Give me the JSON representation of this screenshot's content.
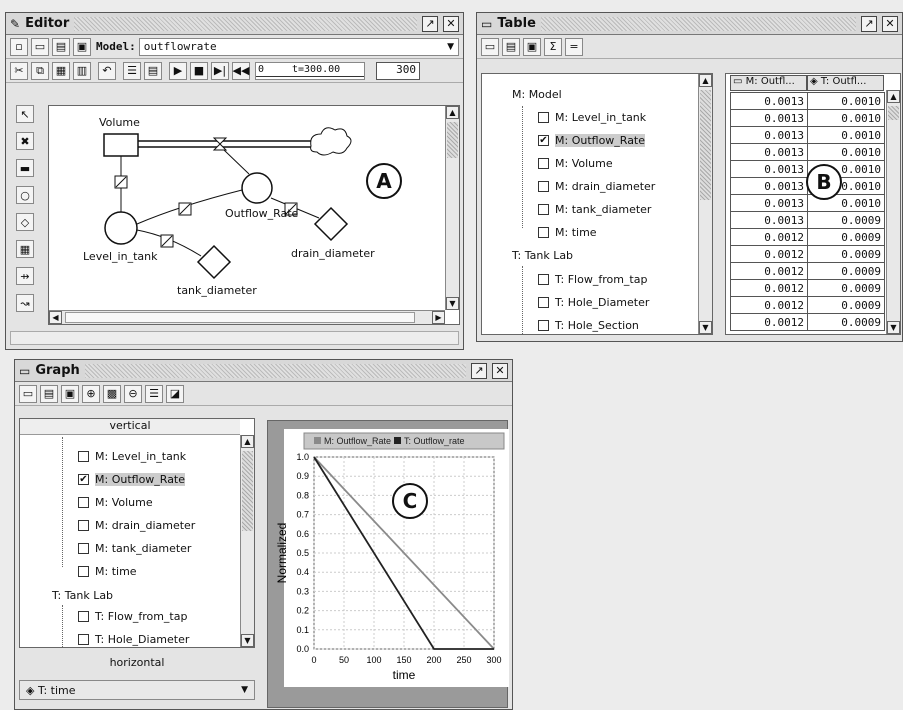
{
  "editor": {
    "title": "Editor",
    "model_label": "Model:",
    "model_value": "outflowrate",
    "time_start": "0",
    "time_display": "t=300.00",
    "time_end": "300",
    "nodes": {
      "volume": "Volume",
      "level": "Level_in_tank",
      "outflow": "Outflow_Rate",
      "drain": "drain_diameter",
      "tank": "tank_diameter"
    },
    "marker": "A"
  },
  "table": {
    "title": "Table",
    "tree": {
      "model_root": "M: Model",
      "model_items": [
        {
          "label": "M: Level_in_tank",
          "checked": false
        },
        {
          "label": "M: Outflow_Rate",
          "checked": true
        },
        {
          "label": "M: Volume",
          "checked": false
        },
        {
          "label": "M: drain_diameter",
          "checked": false
        },
        {
          "label": "M: tank_diameter",
          "checked": false
        },
        {
          "label": "M: time",
          "checked": false
        }
      ],
      "lab_root": "T: Tank Lab",
      "lab_items": [
        {
          "label": "T: Flow_from_tap",
          "checked": false
        },
        {
          "label": "T: Hole_Diameter",
          "checked": false
        },
        {
          "label": "T: Hole_Section",
          "checked": false
        }
      ]
    },
    "col_headers": [
      "M: Outfl...",
      "T: Outfl..."
    ],
    "rows": [
      [
        "0.0013",
        "0.0010"
      ],
      [
        "0.0013",
        "0.0010"
      ],
      [
        "0.0013",
        "0.0010"
      ],
      [
        "0.0013",
        "0.0010"
      ],
      [
        "0.0013",
        "0.0010"
      ],
      [
        "0.0013",
        "0.0010"
      ],
      [
        "0.0013",
        "0.0010"
      ],
      [
        "0.0013",
        "0.0009"
      ],
      [
        "0.0012",
        "0.0009"
      ],
      [
        "0.0012",
        "0.0009"
      ],
      [
        "0.0012",
        "0.0009"
      ],
      [
        "0.0012",
        "0.0009"
      ],
      [
        "0.0012",
        "0.0009"
      ],
      [
        "0.0012",
        "0.0009"
      ]
    ],
    "marker": "B"
  },
  "graph": {
    "title": "Graph",
    "vertical_label": "vertical",
    "tree_items": [
      {
        "label": "M: Level_in_tank",
        "checked": false
      },
      {
        "label": "M: Outflow_Rate",
        "checked": true
      },
      {
        "label": "M: Volume",
        "checked": false
      },
      {
        "label": "M: drain_diameter",
        "checked": false
      },
      {
        "label": "M: tank_diameter",
        "checked": false
      },
      {
        "label": "M: time",
        "checked": false
      }
    ],
    "lab_root": "T: Tank Lab",
    "lab_items": [
      {
        "label": "T: Flow_from_tap",
        "checked": false
      },
      {
        "label": "T: Hole_Diameter",
        "checked": false
      }
    ],
    "horizontal_label": "horizontal",
    "horizontal_value": "T: time",
    "marker": "C"
  },
  "chart_data": {
    "type": "line",
    "xlabel": "time",
    "ylabel": "Normalized",
    "xlim": [
      0,
      300
    ],
    "ylim": [
      0,
      1.0
    ],
    "xticks": [
      "0",
      "50",
      "100",
      "150",
      "200",
      "250",
      "300"
    ],
    "yticks": [
      "0.0",
      "0.1",
      "0.2",
      "0.3",
      "0.4",
      "0.5",
      "0.6",
      "0.7",
      "0.8",
      "0.9",
      "1.0"
    ],
    "legend_position": "top",
    "grid": true,
    "series": [
      {
        "name": "M: Outflow_Rate",
        "color": "#8a8a8a",
        "x": [
          0,
          300
        ],
        "y": [
          1.0,
          0.0
        ]
      },
      {
        "name": "T: Outflow_rate",
        "color": "#222222",
        "x": [
          0,
          200,
          300
        ],
        "y": [
          1.0,
          0.0,
          0.0
        ]
      }
    ]
  }
}
